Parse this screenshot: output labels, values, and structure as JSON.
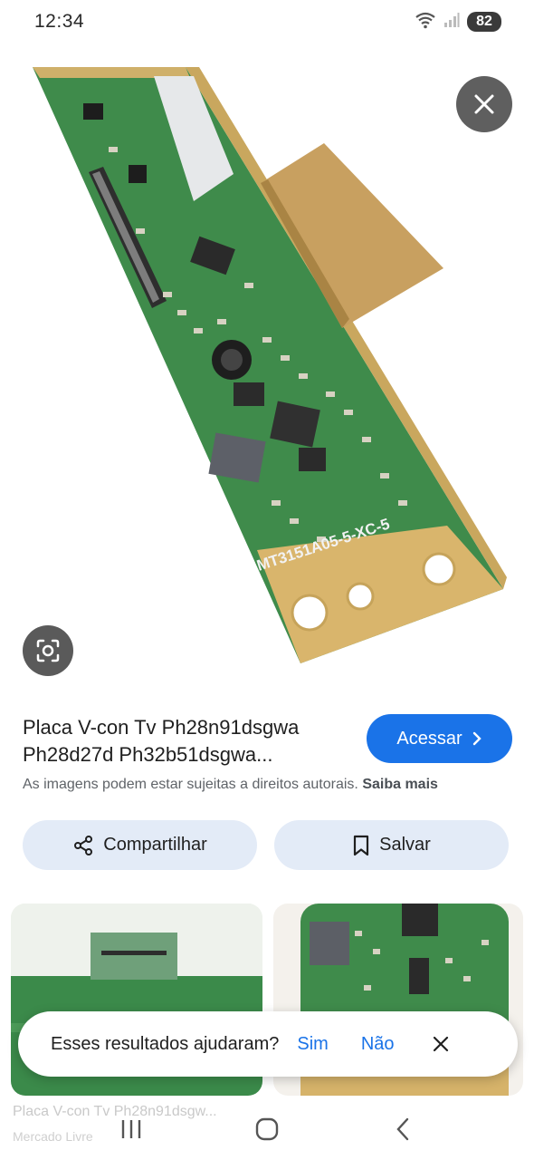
{
  "status_bar": {
    "time": "12:34",
    "battery": "82",
    "icons": [
      "wifi-icon",
      "signal-icon",
      "battery-icon"
    ]
  },
  "viewer": {
    "image_text": "MT3151A05-5-XC-5",
    "close_icon": "close-icon",
    "lens_icon": "lens-icon"
  },
  "result": {
    "title": "Placa V-con Tv Ph28n91dsgwa Ph28d27d Ph32b51dsgwa...",
    "visit_label": "Acessar",
    "copyright_note": "As imagens podem estar sujeitas a direitos autorais.",
    "learn_more": "Saiba mais"
  },
  "actions": {
    "share_label": "Compartilhar",
    "save_label": "Salvar"
  },
  "related": {
    "caption": "Placa V-con Tv Ph28n91dsgw...",
    "source": "Mercado Livre"
  },
  "feedback": {
    "question": "Esses resultados ajudaram?",
    "yes": "Sim",
    "no": "Não"
  },
  "nav": {
    "icons": [
      "recents-icon",
      "home-icon",
      "back-icon"
    ]
  },
  "colors": {
    "accent": "#1a73e8",
    "chip_bg": "#e3ebf7",
    "pcb_green": "#3d8a4a",
    "pcb_gold": "#d8b46a"
  }
}
